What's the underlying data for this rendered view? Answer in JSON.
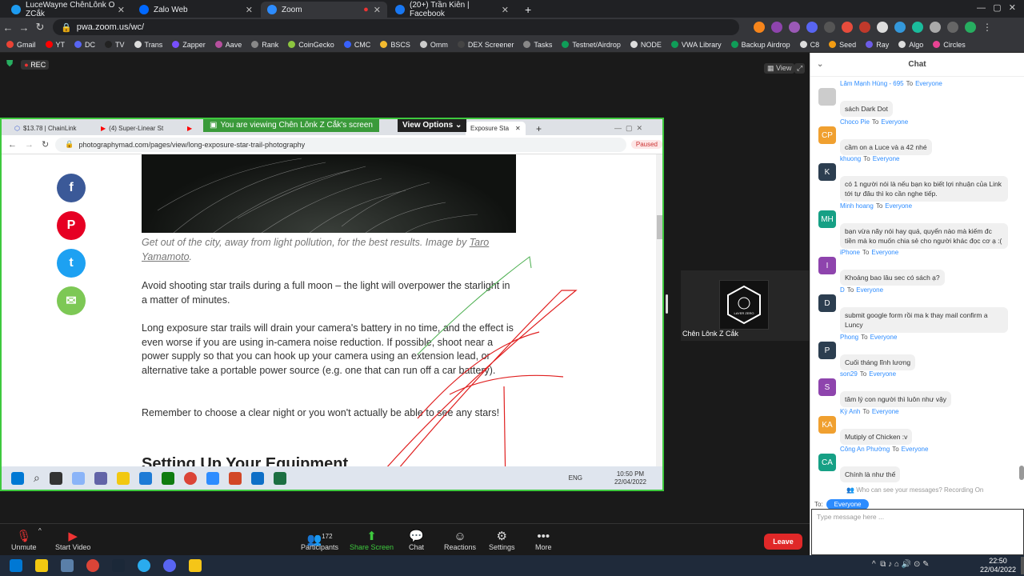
{
  "outer_tabs": [
    {
      "label": "LuceWayne ChênLônk O ZCắk",
      "color": "#1d9bf0"
    },
    {
      "label": "Zalo Web",
      "color": "#0068ff"
    },
    {
      "label": "Zoom",
      "color": "#2d8cff"
    },
    {
      "label": "(20+) Trần Kiên | Facebook",
      "color": "#1877f2"
    }
  ],
  "outer_url": "pwa.zoom.us/wc/",
  "bookmarks": [
    "Gmail",
    "YT",
    "DC",
    "TV",
    "Trans",
    "Zapper",
    "Aave",
    "Rank",
    "CoinGecko",
    "CMC",
    "BSCS",
    "Omm",
    "DEX Screener",
    "Tasks",
    "Testnet/Airdrop",
    "NODE",
    "VWA Library",
    "Backup Airdrop",
    "C8",
    "Seed",
    "Ray",
    "Algo",
    "Circles"
  ],
  "rec_label": "REC",
  "view_label": "View",
  "inner_browser": {
    "tabs": [
      "$13.78 | ChainLink",
      "(4) Super-Linear St",
      "Exposure Sta"
    ],
    "view_banner": "You are viewing Chên Lônk Z Cắk's screen",
    "view_options": "View Options",
    "url": "photographymad.com/pages/view/long-exposure-star-trail-photography",
    "paused": "Paused"
  },
  "article": {
    "caption_pre": "Get out of the city, away from light pollution, for the best results. Image by ",
    "caption_link": "Taro Yamamoto",
    "caption_post": ".",
    "p1": "Avoid shooting star trails during a full moon – the light will overpower the starlight in a matter of minutes.",
    "p2": "Long exposure star trails will drain your camera's battery in no time, and the effect is even worse if you are using in-camera noise reduction. If possible, shoot near a power supply so that you can hook up your camera using an extension lead, or alternative take a portable power source (e.g. one that can run off a car battery).",
    "p3": "Remember to choose a clear night or you won't actually be able to see any stars!",
    "heading": "Setting Up Your Equipment"
  },
  "social": {
    "facebook": "f",
    "pinterest": "P",
    "twitter": "t",
    "email": "✉"
  },
  "inner_taskbar": {
    "lang": "ENG",
    "time": "10:50 PM",
    "date": "22/04/2022"
  },
  "participant_name": "Chên Lônk Z Cắk",
  "logo_text": "LAYER ZERO",
  "zoom_bar": {
    "unmute": "Unmute",
    "start_video": "Start Video",
    "participants": "Participants",
    "participants_count": "172",
    "share_screen": "Share Screen",
    "chat": "Chat",
    "reactions": "Reactions",
    "settings": "Settings",
    "more": "More",
    "leave": "Leave"
  },
  "chat": {
    "title": "Chat",
    "to_word": "To",
    "messages": [
      {
        "initials": "",
        "color": "#cccccc",
        "sender": "Lâm Mạnh Hùng - 695",
        "to": "Everyone",
        "text": "sách Dark Dot"
      },
      {
        "initials": "CP",
        "color": "#f0a030",
        "sender": "Choco Pie",
        "to": "Everyone",
        "text": "cầm on a Luce và a 42 nhé"
      },
      {
        "initials": "K",
        "color": "#2c3e50",
        "sender": "khuong",
        "to": "Everyone",
        "text": "có 1 người nói là nếu bạn ko biết lợi nhuận của Link tới tự đâu thì ko cần nghe tiếp."
      },
      {
        "initials": "MH",
        "color": "#16a085",
        "sender": "Minh hoang",
        "to": "Everyone",
        "text": "bạn vừa nãy nói hay quá, quyển nào mà kiếm đc tiền mà ko muốn chia sẻ cho người khác đọc cơ ạ :("
      },
      {
        "initials": "I",
        "color": "#8e44ad",
        "sender": "iPhone",
        "to": "Everyone",
        "text": "Khoảng bao lâu sec có sách ạ?"
      },
      {
        "initials": "D",
        "color": "#2c3e50",
        "sender": "D",
        "to": "Everyone",
        "text": "submit google form rồi ma k thay mail confirm a Luncy"
      },
      {
        "initials": "P",
        "color": "#2c3e50",
        "sender": "Phong",
        "to": "Everyone",
        "text": "Cuối tháng lĩnh lương"
      },
      {
        "initials": "S",
        "color": "#8e44ad",
        "sender": "son29",
        "to": "Everyone",
        "text": "tâm lý con người thì luôn như vậy"
      },
      {
        "initials": "KA",
        "color": "#f0a030",
        "sender": "Kỳ Anh",
        "to": "Everyone",
        "text": "Mutiply of Chicken :v"
      },
      {
        "initials": "CA",
        "color": "#16a085",
        "sender": "Công An Phường",
        "to": "Everyone",
        "text": "Chính là như thế"
      }
    ],
    "who_can_see": "Who can see your messages? Recording On",
    "to_label": "To:",
    "to_chip": "Everyone",
    "input_placeholder": "Type message here ..."
  },
  "clock": {
    "time": "22:50",
    "date": "22/04/2022"
  }
}
